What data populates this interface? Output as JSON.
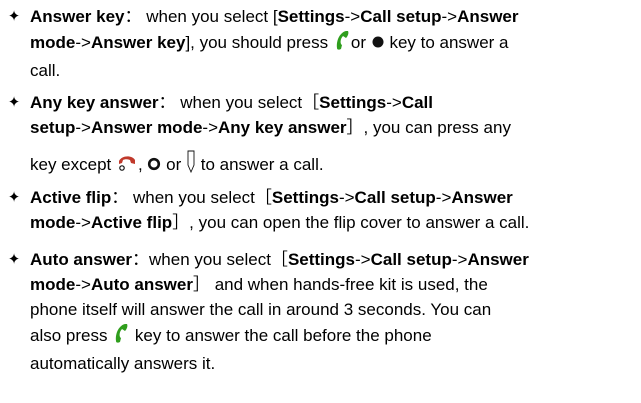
{
  "items": [
    {
      "bullet": "✦",
      "l1": [
        "Answer key",
        "：",
        " when you select [",
        "Settings",
        "->",
        "Call setup",
        "->",
        "Answer"
      ],
      "l2": [
        "mode",
        "->",
        "Answer key",
        "], you should press ",
        "or",
        " key to answer a"
      ],
      "l3": "call."
    },
    {
      "bullet": "✦",
      "l1": [
        "Any key answer",
        "：",
        " when you select［",
        "Settings",
        "->",
        "Call"
      ],
      "l2": [
        "setup",
        "->",
        "Answer mode",
        "->",
        "Any key answer",
        "］, you can press any"
      ],
      "l3": [
        "key except ",
        ", ",
        " or ",
        " to answer a call."
      ]
    },
    {
      "bullet": "✦",
      "l1": [
        "Active flip",
        "：",
        " when you select［",
        "Settings",
        "->",
        "Call setup",
        "->",
        "Answer"
      ],
      "l2": [
        "mode",
        "->",
        "Active flip",
        "］, you can open the flip cover to answer a call."
      ]
    },
    {
      "bullet": "✦",
      "l1": [
        "Auto answer",
        "：",
        "when you select［",
        "Settings",
        "->",
        "Call setup",
        "->",
        "Answer"
      ],
      "l2": [
        "mode",
        "->",
        "Auto answer",
        "］ and when hands-free kit is used, the"
      ],
      "l3": "phone itself will answer the call in around 3 seconds. You can",
      "l4": [
        "also press ",
        " key to answer the call before the phone"
      ],
      "l5": "automatically answers it."
    }
  ],
  "icons": {
    "green": "#2f9e1d",
    "red": "#c0392b",
    "black": "#111111"
  }
}
